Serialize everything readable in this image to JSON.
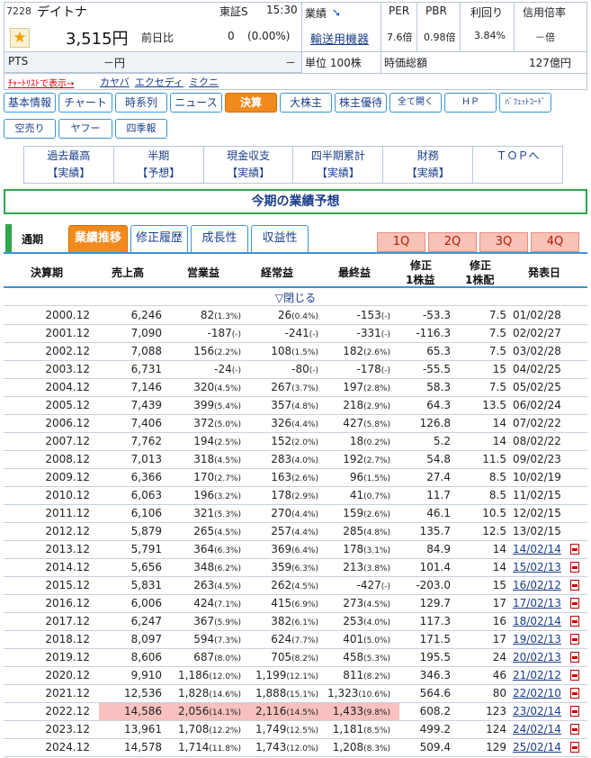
{
  "header": {
    "code": "7228",
    "company": "デイトナ",
    "market": "東証S",
    "time": "15:30",
    "price": "3,515円",
    "prev_label": "前日比",
    "change": "0",
    "change_pct": "(0.00%)",
    "pts_label": "PTS",
    "pts_value": "－円",
    "pts_change": "－",
    "chart_list_text": "ﾁｬｰﾄﾘｽﾄで表示→",
    "chart_links": [
      "カヤバ",
      "エクセディ",
      "ミクニ"
    ],
    "gyoseki_label": "業績",
    "sector": "輸送用機器",
    "unit": "単位 100株",
    "per_label": "PER",
    "per_value": "7.6倍",
    "pbr_label": "PBR",
    "pbr_value": "0.98倍",
    "yield_label": "利回り",
    "yield_value": "3.84%",
    "margin_label": "信用倍率",
    "margin_value": "－倍",
    "mcap_label": "時価総額",
    "mcap_value": "127億円"
  },
  "nav": {
    "row1": [
      "基本情報",
      "チャート",
      "時系列",
      "ニュース",
      "決算",
      "大株主",
      "株主優待",
      "全て開く",
      "ＨＰ",
      "ﾊﾞﾌｪｯﾄｺｰﾄﾞ"
    ],
    "row2": [
      "空売り",
      "ヤフー",
      "四季報"
    ],
    "active": "決算"
  },
  "submenu": [
    {
      "line1": "過去最高",
      "line2": "【実績】"
    },
    {
      "line1": "半期",
      "line2": "【予想】"
    },
    {
      "line1": "現金収支",
      "line2": "【実績】"
    },
    {
      "line1": "四半期累計",
      "line2": "【実績】"
    },
    {
      "line1": "財務",
      "line2": "【実績】"
    },
    {
      "line1": "ＴＯＰへ",
      "line2": ""
    }
  ],
  "forecast_title": "今期の業績予想",
  "tabs": {
    "period_label": "通期",
    "items": [
      "業績推移",
      "修正履歴",
      "成長性",
      "収益性"
    ],
    "active": "業績推移",
    "quarters": [
      "1Q",
      "2Q",
      "3Q",
      "4Q"
    ]
  },
  "table": {
    "headers": {
      "period": "決算期",
      "sales": "売上高",
      "op": "営業益",
      "ord": "経常益",
      "net": "最終益",
      "eps_1": "修正",
      "eps_2": "1株益",
      "div_1": "修正",
      "div_2": "1株配",
      "date": "発表日"
    },
    "close_label": "▽閉じる",
    "rows": [
      {
        "period": "2000.12",
        "sales": "6,246",
        "op": "82",
        "op_p": "(1.3%)",
        "ord": "26",
        "ord_p": "(0.4%)",
        "net": "-153",
        "net_p": "(-)",
        "eps": "-53.3",
        "div": "7.5",
        "date": "01/02/28",
        "link": false
      },
      {
        "period": "2001.12",
        "sales": "7,090",
        "op": "-187",
        "op_p": "(-)",
        "ord": "-241",
        "ord_p": "(-)",
        "net": "-331",
        "net_p": "(-)",
        "eps": "-116.3",
        "div": "7.5",
        "date": "02/02/27",
        "link": false
      },
      {
        "period": "2002.12",
        "sales": "7,088",
        "op": "156",
        "op_p": "(2.2%)",
        "ord": "108",
        "ord_p": "(1.5%)",
        "net": "182",
        "net_p": "(2.6%)",
        "eps": "65.3",
        "div": "7.5",
        "date": "03/02/28",
        "link": false
      },
      {
        "period": "2003.12",
        "sales": "6,731",
        "op": "-24",
        "op_p": "(-)",
        "ord": "-80",
        "ord_p": "(-)",
        "net": "-178",
        "net_p": "(-)",
        "eps": "-55.5",
        "div": "15",
        "date": "04/02/25",
        "link": false
      },
      {
        "period": "2004.12",
        "sales": "7,146",
        "op": "320",
        "op_p": "(4.5%)",
        "ord": "267",
        "ord_p": "(3.7%)",
        "net": "197",
        "net_p": "(2.8%)",
        "eps": "58.3",
        "div": "7.5",
        "date": "05/02/25",
        "link": false
      },
      {
        "period": "2005.12",
        "sales": "7,439",
        "op": "399",
        "op_p": "(5.4%)",
        "ord": "357",
        "ord_p": "(4.8%)",
        "net": "218",
        "net_p": "(2.9%)",
        "eps": "64.3",
        "div": "13.5",
        "date": "06/02/24",
        "link": false
      },
      {
        "period": "2006.12",
        "sales": "7,406",
        "op": "372",
        "op_p": "(5.0%)",
        "ord": "326",
        "ord_p": "(4.4%)",
        "net": "427",
        "net_p": "(5.8%)",
        "eps": "126.8",
        "div": "14",
        "date": "07/02/22",
        "link": false
      },
      {
        "period": "2007.12",
        "sales": "7,762",
        "op": "194",
        "op_p": "(2.5%)",
        "ord": "152",
        "ord_p": "(2.0%)",
        "net": "18",
        "net_p": "(0.2%)",
        "eps": "5.2",
        "div": "14",
        "date": "08/02/22",
        "link": false
      },
      {
        "period": "2008.12",
        "sales": "7,013",
        "op": "318",
        "op_p": "(4.5%)",
        "ord": "283",
        "ord_p": "(4.0%)",
        "net": "192",
        "net_p": "(2.7%)",
        "eps": "54.8",
        "div": "11.5",
        "date": "09/02/23",
        "link": false
      },
      {
        "period": "2009.12",
        "sales": "6,366",
        "op": "170",
        "op_p": "(2.7%)",
        "ord": "163",
        "ord_p": "(2.6%)",
        "net": "96",
        "net_p": "(1.5%)",
        "eps": "27.4",
        "div": "8.5",
        "date": "10/02/19",
        "link": false
      },
      {
        "period": "2010.12",
        "sales": "6,063",
        "op": "196",
        "op_p": "(3.2%)",
        "ord": "178",
        "ord_p": "(2.9%)",
        "net": "41",
        "net_p": "(0.7%)",
        "eps": "11.7",
        "div": "8.5",
        "date": "11/02/15",
        "link": false
      },
      {
        "period": "2011.12",
        "sales": "6,106",
        "op": "321",
        "op_p": "(5.3%)",
        "ord": "270",
        "ord_p": "(4.4%)",
        "net": "159",
        "net_p": "(2.6%)",
        "eps": "46.1",
        "div": "10.5",
        "date": "12/02/15",
        "link": false
      },
      {
        "period": "2012.12",
        "sales": "5,879",
        "op": "265",
        "op_p": "(4.5%)",
        "ord": "257",
        "ord_p": "(4.4%)",
        "net": "285",
        "net_p": "(4.8%)",
        "eps": "135.7",
        "div": "12.5",
        "date": "13/02/15",
        "link": false
      },
      {
        "period": "2013.12",
        "sales": "5,791",
        "op": "364",
        "op_p": "(6.3%)",
        "ord": "369",
        "ord_p": "(6.4%)",
        "net": "178",
        "net_p": "(3.1%)",
        "eps": "84.9",
        "div": "14",
        "date": "14/02/14",
        "link": true
      },
      {
        "period": "2014.12",
        "sales": "5,656",
        "op": "348",
        "op_p": "(6.2%)",
        "ord": "359",
        "ord_p": "(6.3%)",
        "net": "213",
        "net_p": "(3.8%)",
        "eps": "101.4",
        "div": "14",
        "date": "15/02/13",
        "link": true
      },
      {
        "period": "2015.12",
        "sales": "5,831",
        "op": "263",
        "op_p": "(4.5%)",
        "ord": "262",
        "ord_p": "(4.5%)",
        "net": "-427",
        "net_p": "(-)",
        "eps": "-203.0",
        "div": "15",
        "date": "16/02/12",
        "link": true
      },
      {
        "period": "2016.12",
        "sales": "6,006",
        "op": "424",
        "op_p": "(7.1%)",
        "ord": "415",
        "ord_p": "(6.9%)",
        "net": "273",
        "net_p": "(4.5%)",
        "eps": "129.7",
        "div": "17",
        "date": "17/02/13",
        "link": true
      },
      {
        "period": "2017.12",
        "sales": "6,247",
        "op": "367",
        "op_p": "(5.9%)",
        "ord": "382",
        "ord_p": "(6.1%)",
        "net": "253",
        "net_p": "(4.0%)",
        "eps": "117.3",
        "div": "16",
        "date": "18/02/14",
        "link": true
      },
      {
        "period": "2018.12",
        "sales": "8,097",
        "op": "594",
        "op_p": "(7.3%)",
        "ord": "624",
        "ord_p": "(7.7%)",
        "net": "401",
        "net_p": "(5.0%)",
        "eps": "171.5",
        "div": "17",
        "date": "19/02/13",
        "link": true
      },
      {
        "period": "2019.12",
        "sales": "8,606",
        "op": "687",
        "op_p": "(8.0%)",
        "ord": "705",
        "ord_p": "(8.2%)",
        "net": "458",
        "net_p": "(5.3%)",
        "eps": "195.5",
        "div": "24",
        "date": "20/02/13",
        "link": true
      },
      {
        "period": "2020.12",
        "sales": "9,910",
        "op": "1,186",
        "op_p": "(12.0%)",
        "ord": "1,199",
        "ord_p": "(12.1%)",
        "net": "811",
        "net_p": "(8.2%)",
        "eps": "346.3",
        "div": "46",
        "date": "21/02/12",
        "link": true
      },
      {
        "period": "2021.12",
        "sales": "12,536",
        "op": "1,828",
        "op_p": "(14.6%)",
        "ord": "1,888",
        "ord_p": "(15.1%)",
        "net": "1,323",
        "net_p": "(10.6%)",
        "eps": "564.6",
        "div": "80",
        "date": "22/02/10",
        "link": true
      },
      {
        "period": "2022.12",
        "sales": "14,586",
        "op": "2,056",
        "op_p": "(14.1%)",
        "ord": "2,116",
        "ord_p": "(14.5%)",
        "net": "1,433",
        "net_p": "(9.8%)",
        "eps": "608.2",
        "div": "123",
        "date": "23/02/14",
        "link": true,
        "highlight": true
      },
      {
        "period": "2023.12",
        "sales": "13,961",
        "op": "1,708",
        "op_p": "(12.2%)",
        "ord": "1,749",
        "ord_p": "(12.5%)",
        "net": "1,181",
        "net_p": "(8.5%)",
        "eps": "499.2",
        "div": "124",
        "date": "24/02/14",
        "link": true
      },
      {
        "period": "2024.12",
        "sales": "14,578",
        "op": "1,714",
        "op_p": "(11.8%)",
        "ord": "1,743",
        "ord_p": "(12.0%)",
        "net": "1,208",
        "net_p": "(8.3%)",
        "eps": "509.4",
        "div": "129",
        "date": "25/02/14",
        "link": true
      }
    ]
  },
  "colors": {
    "accent": "#f08a1c",
    "link": "#1a3e8a",
    "tab_border": "#3c95d4",
    "forecast_border": "#2fa64a",
    "highlight": "#f8c0c0",
    "quarter_btn": "#f8c2b8"
  }
}
